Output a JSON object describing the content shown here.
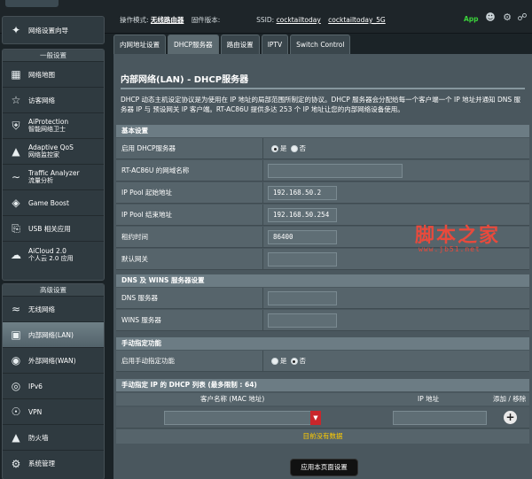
{
  "header": {
    "mode_label": "操作模式:",
    "mode_value": "无线路由器",
    "firmware_label": "固件版本:",
    "ssid_label": "SSID:",
    "ssid_24": "cocktailtoday",
    "ssid_5": "cocktailtoday_5G",
    "app_label": "App"
  },
  "sidebar": {
    "wizard": "网络设置向导",
    "general_head": "一般设置",
    "general_items": [
      {
        "label": "网络地图",
        "sub": ""
      },
      {
        "label": "访客网络",
        "sub": ""
      },
      {
        "label": "AiProtection",
        "sub": "智能网络卫士"
      },
      {
        "label": "Adaptive QoS",
        "sub": "网络监控家"
      },
      {
        "label": "Traffic Analyzer",
        "sub": "流量分析"
      },
      {
        "label": "Game Boost",
        "sub": ""
      },
      {
        "label": "USB 相关应用",
        "sub": ""
      },
      {
        "label": "AiCloud 2.0",
        "sub": "个人云 2.0 应用"
      }
    ],
    "advanced_head": "高级设置",
    "advanced_items": [
      {
        "label": "无线网络"
      },
      {
        "label": "内部网络(LAN)"
      },
      {
        "label": "外部网络(WAN)"
      },
      {
        "label": "IPv6"
      },
      {
        "label": "VPN"
      },
      {
        "label": "防火墙"
      },
      {
        "label": "系统管理"
      }
    ]
  },
  "tabs": [
    {
      "label": "内网地址设置"
    },
    {
      "label": "DHCP服务器"
    },
    {
      "label": "路由设置"
    },
    {
      "label": "IPTV"
    },
    {
      "label": "Switch Control"
    }
  ],
  "page": {
    "title": "内部网络(LAN) - DHCP服务器",
    "description": "DHCP 动态主机设定协议是为使用在 IP 地址的局部范围所制定的协议。DHCP 服务器会分配给每一个客户端一个 IP 地址并通知 DNS 服务器 IP 与 预设网关 IP 客户端。RT-AC86U 提供多达 253 个 IP 地址让您的内部网络设备使用。"
  },
  "basic": {
    "head": "基本设置",
    "enable_dhcp_label": "启用 DHCP服务器",
    "yes": "是",
    "no": "否",
    "domain_label": "RT-AC86U 的网域名称",
    "domain_value": "",
    "start_label": "IP Pool 起始地址",
    "start_value": "192.168.50.2",
    "end_label": "IP Pool 结束地址",
    "end_value": "192.168.50.254",
    "lease_label": "租约时间",
    "lease_value": "86400",
    "gateway_label": "默认网关",
    "gateway_value": ""
  },
  "dns": {
    "head": "DNS 及 WINS 服务器设置",
    "dns_label": "DNS 服务器",
    "dns_value": "",
    "wins_label": "WINS 服务器",
    "wins_value": ""
  },
  "manual": {
    "head": "手动指定功能",
    "enable_label": "启用手动指定功能",
    "yes": "是",
    "no": "否"
  },
  "list": {
    "head": "手动指定 IP 的 DHCP 列表 (最多限制 : 64)",
    "col_client": "客户名称 (MAC 地址)",
    "col_ip": "IP 地址",
    "col_action": "添加 / 移除",
    "empty": "目前没有数据"
  },
  "apply_label": "应用本页面设置",
  "watermark": {
    "main": "脚本之家",
    "url": "www.jb51.net"
  }
}
